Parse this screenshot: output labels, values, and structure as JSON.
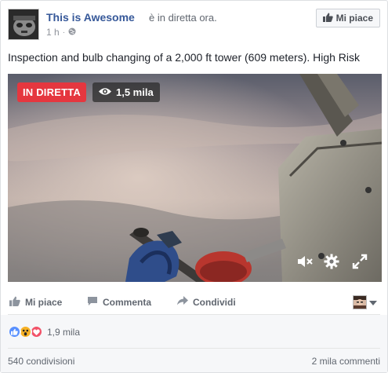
{
  "header": {
    "page_name": "This is Awesome",
    "live_text": "è in diretta ora.",
    "time": "1 h",
    "time_separator": "·",
    "like_page_label": "Mi piace"
  },
  "post": {
    "text": "Inspection and bulb changing of a 2,000 ft tower (609 meters). High Risk"
  },
  "video": {
    "live_badge": "IN DIRETTA",
    "viewers": "1,5 mila",
    "live_color": "#e5373f"
  },
  "actions": {
    "like": "Mi piace",
    "comment": "Commenta",
    "share": "Condividi"
  },
  "stats": {
    "reactions_count": "1,9 mila",
    "shares": "540 condivisioni",
    "comments": "2 mila commenti"
  },
  "icons": [
    "thumbs-up-icon",
    "globe-icon",
    "eye-icon",
    "mute-icon",
    "gear-icon",
    "fullscreen-icon",
    "comment-icon",
    "share-icon",
    "caret-down-icon",
    "like-reaction-icon",
    "wow-reaction-icon",
    "love-reaction-icon"
  ],
  "colors": {
    "link": "#365899",
    "muted": "#616770",
    "footer_bg": "#f6f7f9"
  }
}
